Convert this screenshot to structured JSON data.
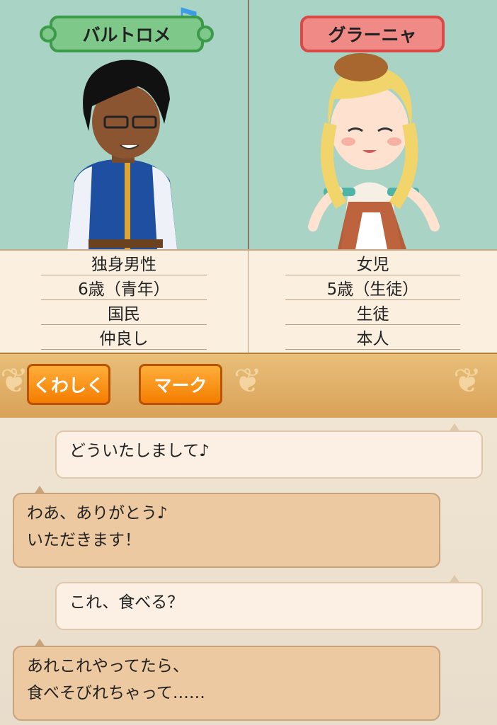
{
  "left_character": {
    "name": "バルトロメ",
    "stats": [
      "独身男性",
      "6歳（青年）",
      "国民",
      "仲良し"
    ]
  },
  "right_character": {
    "name": "グラーニャ",
    "stats": [
      "女児",
      "5歳（生徒）",
      "生徒",
      "本人"
    ]
  },
  "toolbar": {
    "details_label": "くわしく",
    "mark_label": "マーク"
  },
  "chat": [
    {
      "speaker": "right",
      "lines": [
        "どういたしまして♪"
      ]
    },
    {
      "speaker": "left",
      "lines": [
        "わあ、ありがとう♪",
        "いただきます！"
      ]
    },
    {
      "speaker": "right",
      "lines": [
        "これ、食べる？"
      ]
    },
    {
      "speaker": "left",
      "lines": [
        "あれこれやってたら、",
        "食べそびれちゃって……"
      ]
    }
  ],
  "colors": {
    "left_tag": "#7ec88a",
    "right_tag": "#f08a86",
    "button": "#f47d00",
    "portrait_bg": "#a9d3c5"
  },
  "icons": [
    "music-note-icon",
    "ornament-icon"
  ]
}
